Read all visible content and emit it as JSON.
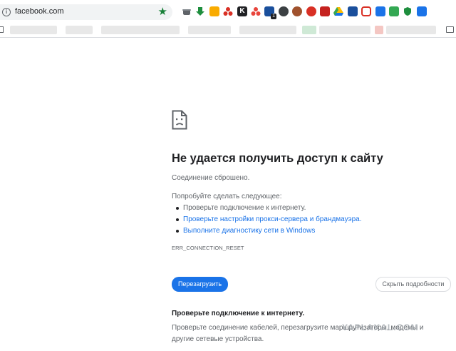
{
  "toolbar": {
    "url": "facebook.com",
    "extensions": [
      {
        "name": "ext-grey-hat-icon",
        "color": "#5f6368"
      },
      {
        "name": "ext-green-arrow-icon",
        "color": "#1e8e3e"
      },
      {
        "name": "ext-yellow-face-icon",
        "color": "#f9ab00"
      },
      {
        "name": "ext-red-circles-icon",
        "color": "#d93025"
      },
      {
        "name": "ext-k-icon",
        "color": "#202124",
        "text": "K"
      },
      {
        "name": "ext-three-dots-icon",
        "color": "#e8453c"
      },
      {
        "name": "ext-blue-square-icon",
        "color": "#1a4f9c",
        "badge": "1"
      },
      {
        "name": "ext-avatar-dark-icon",
        "color": "#3c4043"
      },
      {
        "name": "ext-avatar-brown-icon",
        "color": "#a0522d"
      },
      {
        "name": "ext-flower-icon",
        "color": "#d93025"
      },
      {
        "name": "ext-window-red-icon",
        "color": "#c5221f"
      },
      {
        "name": "ext-drive-icon",
        "color": "#1a73e8"
      },
      {
        "name": "ext-pn-icon",
        "color": "#1a4f9c"
      },
      {
        "name": "ext-red-clock-icon",
        "color": "#d93025"
      },
      {
        "name": "ext-translate-icon",
        "color": "#1a73e8"
      },
      {
        "name": "ext-green-square-icon",
        "color": "#34a853"
      },
      {
        "name": "ext-shield-icon",
        "color": "#1e8e3e"
      },
      {
        "name": "ext-blue-badge-icon",
        "color": "#1a73e8"
      }
    ]
  },
  "error": {
    "title": "Не удается получить доступ к сайту",
    "subtitle": "Соединение сброшено.",
    "try_label": "Попробуйте сделать следующее:",
    "suggestions": [
      "Проверьте подключение к интернету.",
      "Проверьте настройки прокси-сервера и брандмауэра.",
      "Выполните диагностику сети в Windows"
    ],
    "code": "ERR_CONNECTION_RESET",
    "reload_label": "Перезагрузить",
    "details_label": "Скрыть подробности",
    "details_heading": "Проверьте подключение к интернету.",
    "details_text": "Проверьте соединение кабелей, перезагрузите маршрутизаторы, модемы и другие сетевые устройства."
  },
  "watermark": "YAPLAKAL.COM",
  "colors": {
    "accent": "#1a73e8",
    "text": "#202124",
    "muted": "#5f6368"
  }
}
